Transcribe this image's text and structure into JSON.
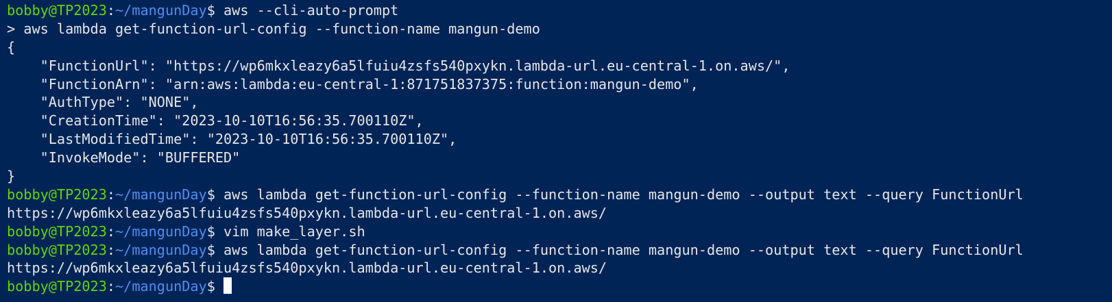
{
  "terminal": {
    "prompt": {
      "user_host": "bobby@TP2023",
      "separator": ":",
      "path": "~/mangunDay",
      "symbol": "$ "
    },
    "lines": [
      {
        "type": "prompt",
        "cmd": "aws --cli-auto-prompt"
      },
      {
        "type": "output",
        "text": "> aws lambda get-function-url-config --function-name mangun-demo"
      },
      {
        "type": "output",
        "text": "{"
      },
      {
        "type": "output",
        "text": "    \"FunctionUrl\": \"https://wp6mkxleazy6a5lfuiu4zsfs540pxykn.lambda-url.eu-central-1.on.aws/\","
      },
      {
        "type": "output",
        "text": "    \"FunctionArn\": \"arn:aws:lambda:eu-central-1:871751837375:function:mangun-demo\","
      },
      {
        "type": "output",
        "text": "    \"AuthType\": \"NONE\","
      },
      {
        "type": "output",
        "text": "    \"CreationTime\": \"2023-10-10T16:56:35.700110Z\","
      },
      {
        "type": "output",
        "text": "    \"LastModifiedTime\": \"2023-10-10T16:56:35.700110Z\","
      },
      {
        "type": "output",
        "text": "    \"InvokeMode\": \"BUFFERED\""
      },
      {
        "type": "output",
        "text": "}"
      },
      {
        "type": "prompt",
        "cmd": "aws lambda get-function-url-config --function-name mangun-demo --output text --query FunctionUrl"
      },
      {
        "type": "output",
        "text": "https://wp6mkxleazy6a5lfuiu4zsfs540pxykn.lambda-url.eu-central-1.on.aws/"
      },
      {
        "type": "prompt",
        "cmd": "vim make_layer.sh"
      },
      {
        "type": "prompt",
        "cmd": "aws lambda get-function-url-config --function-name mangun-demo --output text --query FunctionUrl"
      },
      {
        "type": "output",
        "text": "https://wp6mkxleazy6a5lfuiu4zsfs540pxykn.lambda-url.eu-central-1.on.aws/"
      },
      {
        "type": "prompt",
        "cmd": "",
        "cursor": true
      }
    ]
  },
  "colors": {
    "background": "#012456",
    "user_host": "#5fd700",
    "path": "#4f8df0",
    "text": "#e6e6e6",
    "cursor": "#ffffff"
  }
}
